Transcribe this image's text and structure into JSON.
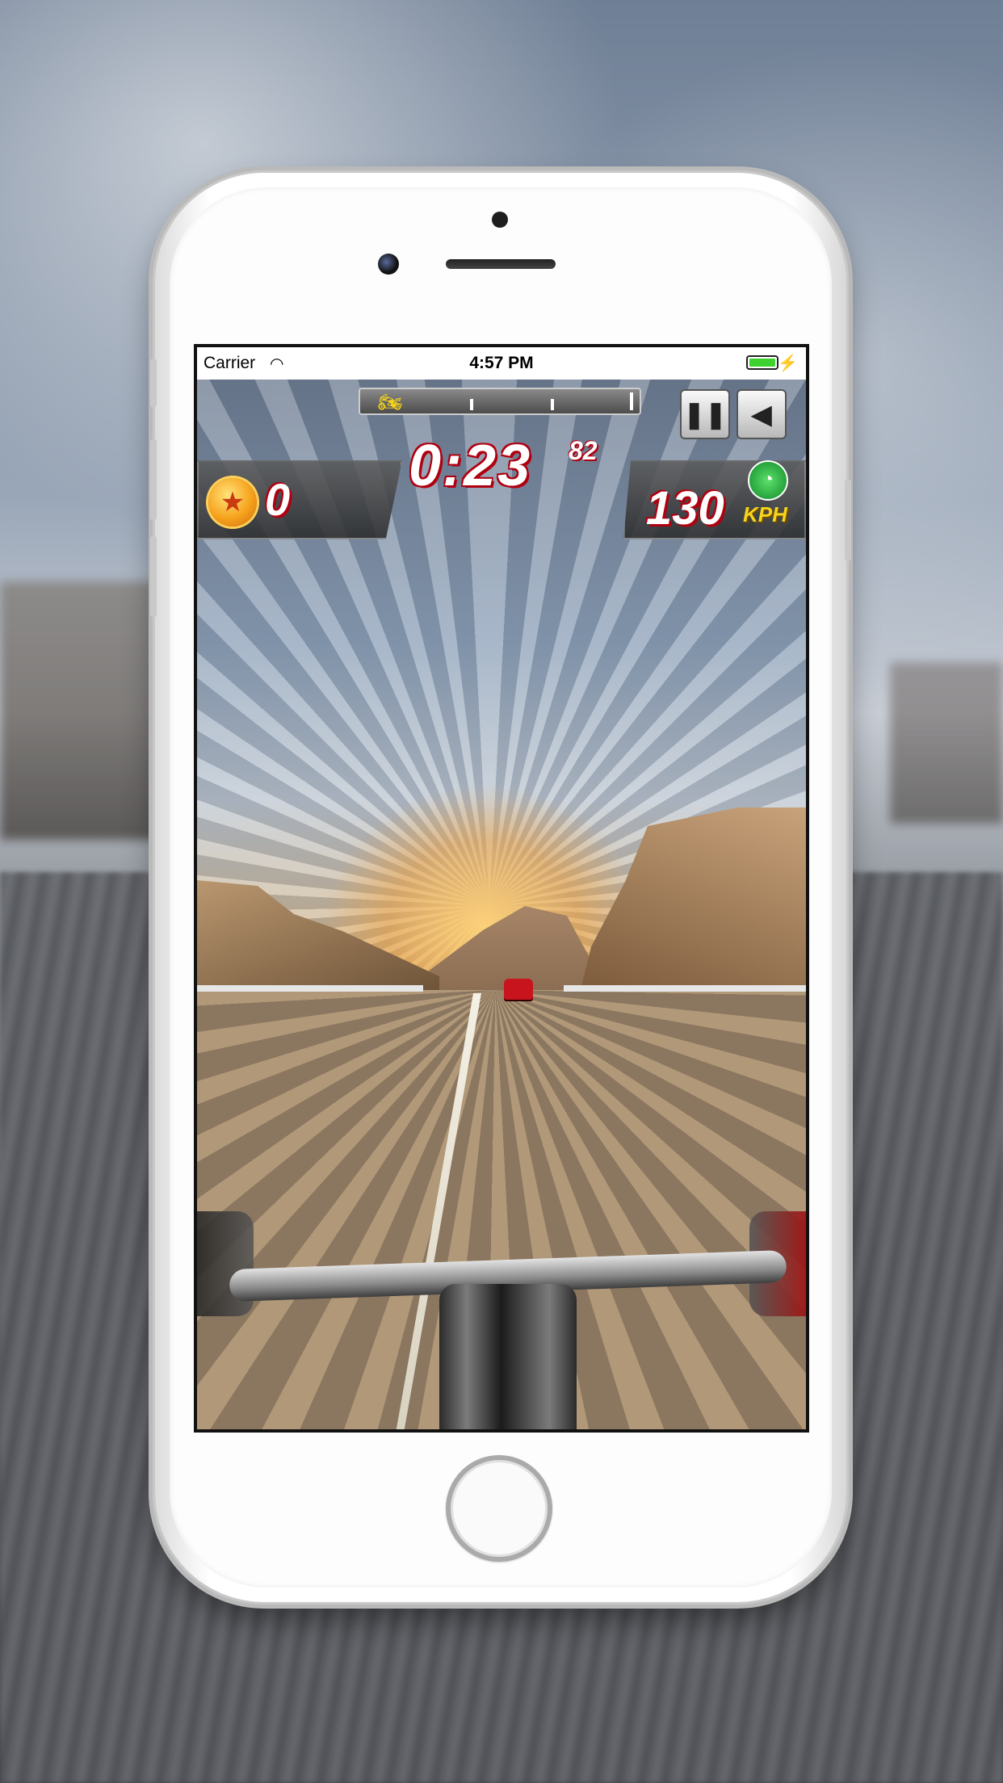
{
  "status_bar": {
    "carrier": "Carrier",
    "time": "4:57 PM",
    "battery_level": 1.0,
    "icons": [
      "wifi-icon",
      "battery-icon",
      "charging-bolt-icon"
    ]
  },
  "hud": {
    "timer_main": "0:23",
    "timer_fraction": "82",
    "coins": "0",
    "speed_value": "130",
    "speed_unit": "KPH",
    "progress_icon": "motorcycle-icon",
    "buttons": {
      "pause_icon": "pause-icon",
      "sound_icon": "speaker-icon"
    },
    "colors": {
      "text_outline": "#b00010",
      "unit": "#f7d41c",
      "progress_marker": "#f4d21a"
    }
  }
}
